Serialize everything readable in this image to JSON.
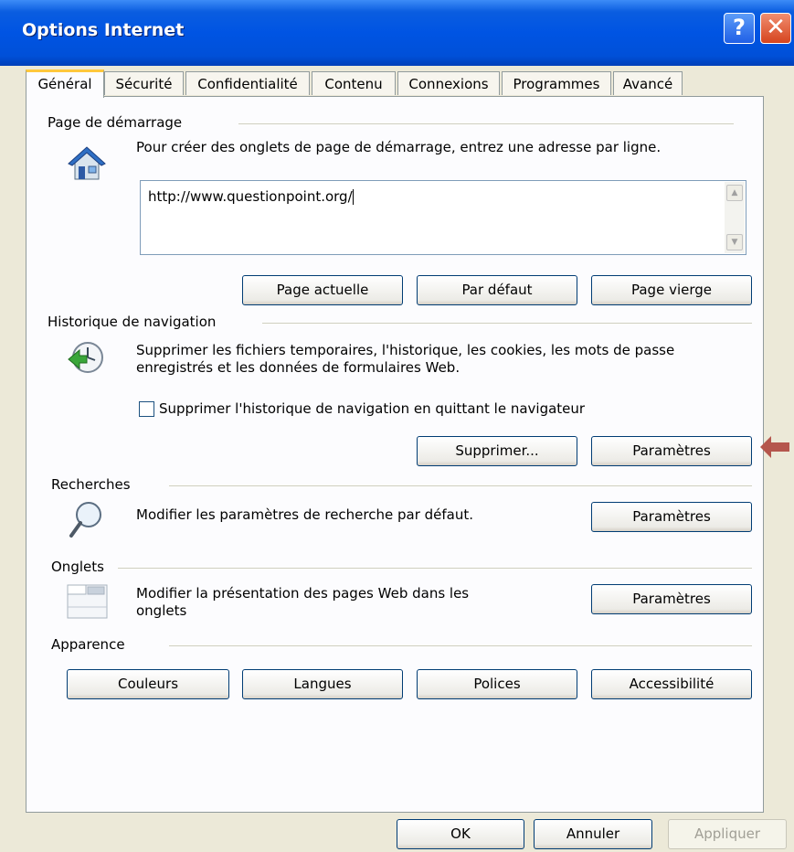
{
  "window": {
    "title": "Options Internet",
    "help_label": "?",
    "close_label": "✕"
  },
  "tabs": [
    "Général",
    "Sécurité",
    "Confidentialité",
    "Contenu",
    "Connexions",
    "Programmes",
    "Avancé"
  ],
  "home": {
    "group": "Page de démarrage",
    "description": "Pour créer des onglets de page de démarrage, entrez une adresse par ligne.",
    "url_value": "http://www.questionpoint.org/",
    "buttons": {
      "current": "Page actuelle",
      "default": "Par défaut",
      "blank": "Page vierge"
    },
    "icon": "home-icon"
  },
  "history": {
    "group": "Historique de navigation",
    "description_line1": "Supprimer les fichiers temporaires, l'historique, les cookies, les mots de passe",
    "description_line2": "enregistrés et les données de formulaires Web.",
    "checkbox_label": "Supprimer l'historique de navigation en quittant le navigateur",
    "checkbox_checked": false,
    "buttons": {
      "delete": "Supprimer...",
      "settings": "Paramètres"
    },
    "icon": "history-clock-icon"
  },
  "search": {
    "group": "Recherches",
    "description": "Modifier les paramètres de recherche par défaut.",
    "button": "Paramètres",
    "icon": "magnifier-icon"
  },
  "tabs_section": {
    "group": "Onglets",
    "description_line1": "Modifier la présentation des pages Web dans les",
    "description_line2": "onglets",
    "button": "Paramètres",
    "icon": "tabs-window-icon"
  },
  "appearance": {
    "group": "Apparence",
    "buttons": {
      "colors": "Couleurs",
      "languages": "Langues",
      "fonts": "Polices",
      "accessibility": "Accessibilité"
    }
  },
  "footer": {
    "ok": "OK",
    "cancel": "Annuler",
    "apply": "Appliquer"
  },
  "colors": {
    "title_bar": "#0054e3",
    "face": "#ece9d8",
    "annotation_arrow": "#b5564d",
    "active_tab_accent": "#ffc83c"
  }
}
